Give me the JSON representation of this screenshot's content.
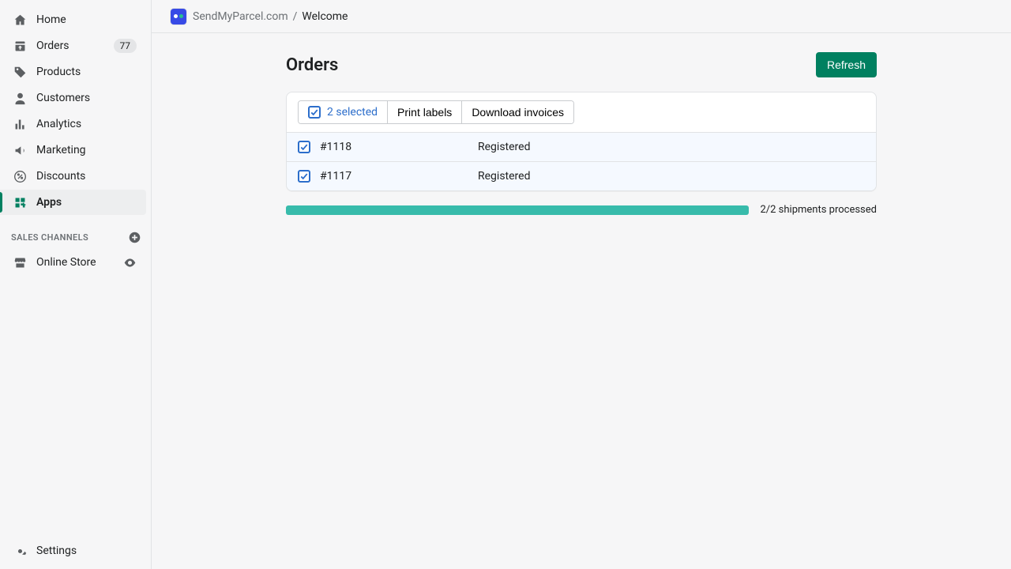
{
  "sidebar": {
    "items": [
      {
        "label": "Home",
        "icon": "home-icon"
      },
      {
        "label": "Orders",
        "icon": "orders-icon",
        "badge": "77"
      },
      {
        "label": "Products",
        "icon": "products-icon"
      },
      {
        "label": "Customers",
        "icon": "customers-icon"
      },
      {
        "label": "Analytics",
        "icon": "analytics-icon"
      },
      {
        "label": "Marketing",
        "icon": "marketing-icon"
      },
      {
        "label": "Discounts",
        "icon": "discounts-icon"
      },
      {
        "label": "Apps",
        "icon": "apps-icon",
        "active": true
      }
    ],
    "section_header": "SALES CHANNELS",
    "channels": [
      {
        "label": "Online Store",
        "icon": "store-icon"
      }
    ],
    "settings_label": "Settings"
  },
  "breadcrumb": {
    "app": "SendMyParcel.com",
    "page": "Welcome"
  },
  "page": {
    "title": "Orders",
    "refresh_label": "Refresh"
  },
  "bulk": {
    "selected_label": "2 selected",
    "print_label": "Print labels",
    "download_label": "Download invoices"
  },
  "orders": [
    {
      "id": "#1118",
      "status": "Registered",
      "checked": true
    },
    {
      "id": "#1117",
      "status": "Registered",
      "checked": true
    }
  ],
  "progress": {
    "percent": 100,
    "text": "2/2 shipments processed"
  }
}
